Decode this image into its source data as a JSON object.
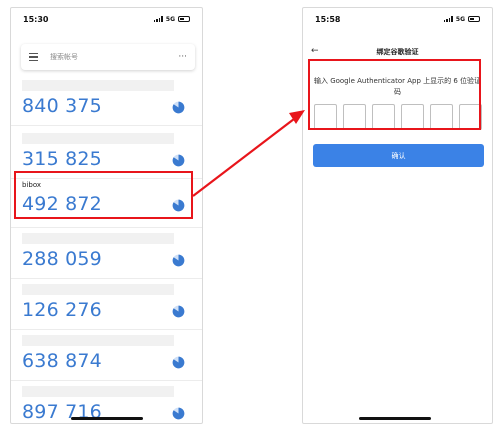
{
  "left_phone": {
    "status_time": "15:30",
    "network": "5G",
    "search_placeholder": "搜索帐号",
    "more_label": "···",
    "items": [
      {
        "issuer": "",
        "code": "840 375"
      },
      {
        "issuer": "",
        "code": "315 825"
      },
      {
        "issuer": "bibox",
        "code": "492 872"
      },
      {
        "issuer": "",
        "code": "288 059"
      },
      {
        "issuer": "",
        "code": "126 276"
      },
      {
        "issuer": "",
        "code": "638 874"
      },
      {
        "issuer": "",
        "code": "897 716"
      }
    ]
  },
  "right_phone": {
    "status_time": "15:58",
    "network": "5G",
    "back_label": "←",
    "title": "绑定谷歌验证",
    "instruction": "输入 Google Authenticator App 上显示的 6 位验证码",
    "confirm_label": "确认"
  },
  "colors": {
    "code_blue": "#3a7ad0",
    "button_blue": "#3b82e6",
    "annotation_red": "#e8151b"
  }
}
